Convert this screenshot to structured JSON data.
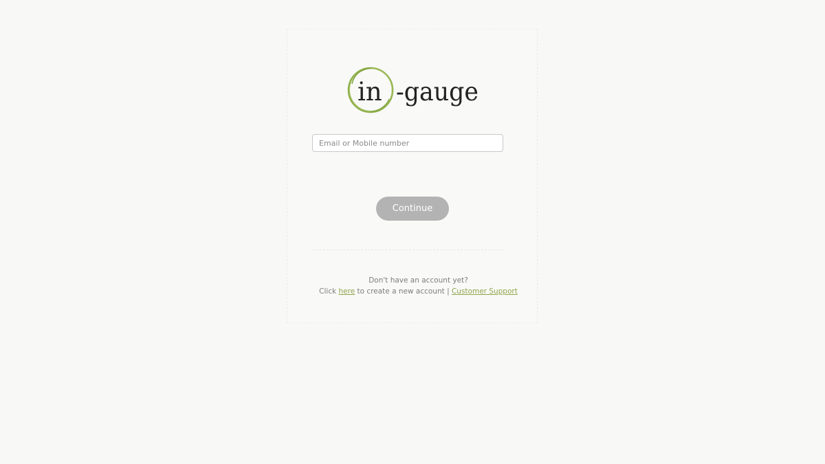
{
  "logo": {
    "text_in": "in",
    "text_rest": "-gauge",
    "ring_color": "#8fb04a",
    "text_color": "#222222"
  },
  "login": {
    "email_placeholder": "Email or Mobile number",
    "email_value": "",
    "continue_label": "Continue"
  },
  "footer": {
    "no_account": "Don't have an account yet?",
    "click": "Click",
    "here_link": "here",
    "create_text": "to create a new account |",
    "support_link": "Customer Support"
  },
  "colors": {
    "background": "#f8f8f7",
    "button": "#b3b3b3",
    "link": "#8fa54a"
  }
}
